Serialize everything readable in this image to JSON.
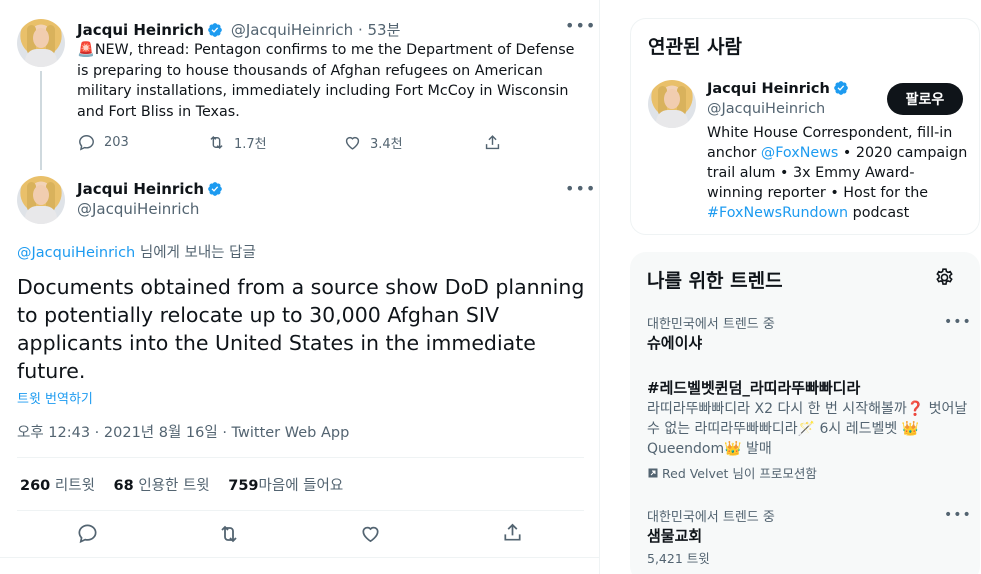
{
  "tweet1": {
    "author_name": "Jacqui Heinrich",
    "handle": "@JacquiHeinrich",
    "time": "53분",
    "emoji": "🚨",
    "text": "NEW, thread: Pentagon confirms to me the Department of Defense is preparing to house thousands of Afghan refugees on American military installations, immediately including Fort McCoy in Wisconsin and Fort Bliss in Texas.",
    "reply_count": "203",
    "retweet_count": "1.7천",
    "like_count": "3.4천"
  },
  "tweet2": {
    "author_name": "Jacqui Heinrich",
    "handle": "@JacquiHeinrich",
    "reply_to_handle": "@JacquiHeinrich",
    "reply_to_suffix": " 님에게 보내는 답글",
    "text": "Documents obtained from a source show DoD planning to potentially relocate up to 30,000 Afghan SIV applicants into the United States in the immediate future.",
    "translate": "트윗 번역하기",
    "meta": "오후 12:43 · 2021년 8월 16일 · Twitter Web App",
    "retweets_num": "260",
    "retweets_label": "리트윗",
    "quotes_num": "68",
    "quotes_label": "인용한 트윗",
    "likes_num": "759",
    "likes_label": "마음에 들어요"
  },
  "related": {
    "title": "연관된 사람",
    "name": "Jacqui Heinrich",
    "handle": "@JacquiHeinrich",
    "follow_label": "팔로우",
    "bio_1": "White House Correspondent, fill-in anchor ",
    "bio_link1": "@FoxNews",
    "bio_2": " • 2020 campaign trail alum • 3x Emmy Award-winning reporter • Host for the ",
    "bio_link2": "#FoxNewsRundown",
    "bio_3": " podcast"
  },
  "trends": {
    "title": "나를 위한 트렌드",
    "items": [
      {
        "context": "대한민국에서 트렌드 중",
        "name": "슈에이샤"
      },
      {
        "name": "#레드벨벳퀸덤_라띠라뚜빠빠디라",
        "desc": "라띠라뚜빠빠디라 X2 다시 한 번 시작해볼까❓ 벗어날 수 없는 라띠라뚜빠빠디라🪄 6시 레드벨벳 👑Queendom👑 발매",
        "promoted": "Red Velvet 님이 프로모션함"
      },
      {
        "context": "대한민국에서 트렌드 중",
        "name": "샘물교회",
        "count": "5,421 트윗"
      }
    ]
  },
  "colors": {
    "accent": "#1d9bf0",
    "text": "#0f1419",
    "muted": "#536471"
  }
}
